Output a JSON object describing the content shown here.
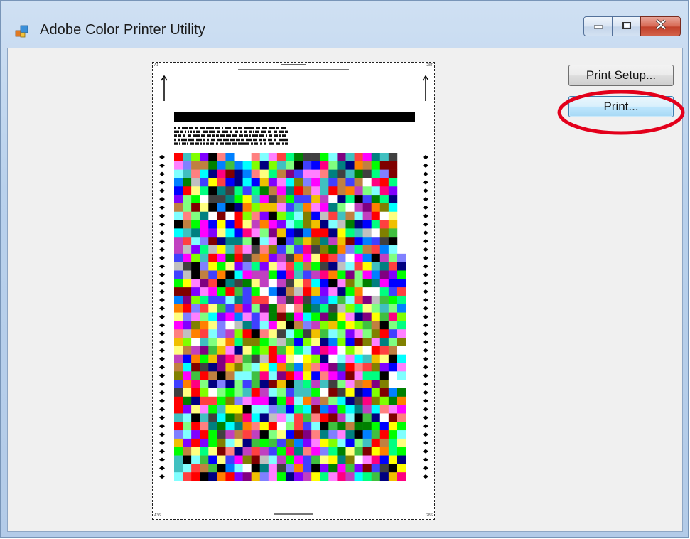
{
  "window": {
    "title": "Adobe Color Printer Utility"
  },
  "icons": {
    "app": "app-window-icon",
    "minimize": "minimize-icon",
    "maximize": "maximize-icon",
    "close": "close-icon"
  },
  "buttons": {
    "print_setup": "Print Setup...",
    "print": "Print..."
  },
  "colors": {
    "client_bg": "#f0f0f0",
    "annotation": "#e3001b",
    "close_button": "#c2412b"
  }
}
